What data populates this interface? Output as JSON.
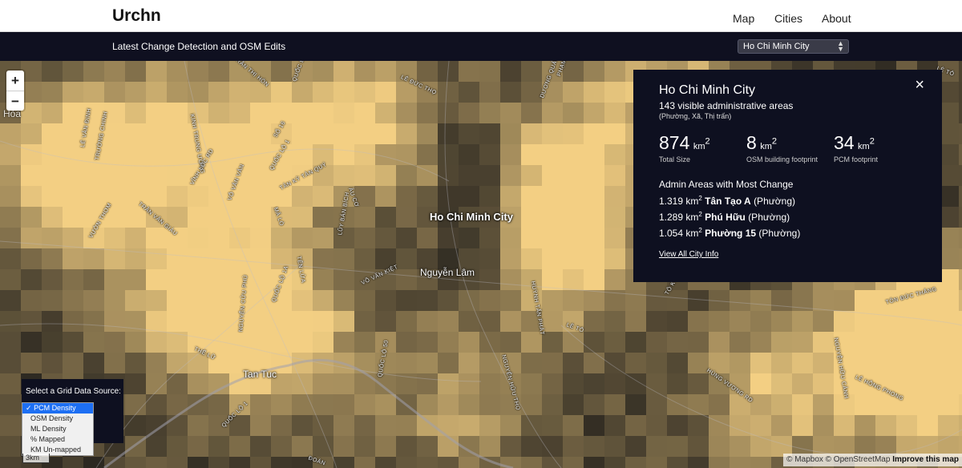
{
  "header": {
    "brand": "Urchn",
    "nav": [
      "Map",
      "Cities",
      "About"
    ]
  },
  "subheader": {
    "title": "Latest Change Detection and OSM Edits",
    "city_select": "Ho Chi Minh City"
  },
  "map": {
    "zoom_in": "+",
    "zoom_out": "−",
    "edge_label": "Hòa",
    "places": {
      "center": "Ho Chi Minh City",
      "nguyen_lam": "Nguyễn Lâm",
      "tan_tuc": "Tan Tuc"
    },
    "streets": [
      {
        "text": "LÊ ĐỨC THỌ"
      },
      {
        "text": "TRẦN THỊ HÒN"
      },
      {
        "text": "TÔ KÝ"
      },
      {
        "text": "QUỐC LỘ 22"
      },
      {
        "text": "DƯƠNG QUẢNG HÀM"
      },
      {
        "text": "SỐ 16"
      },
      {
        "text": "TÂN KỲ TÂN QUÝ"
      },
      {
        "text": "QUỐC LỘ 1"
      },
      {
        "text": "TRƯỜNG CHINH"
      },
      {
        "text": "KINH TRUNG ƯƠNG"
      },
      {
        "text": "VĨNH LỘC RD"
      },
      {
        "text": "VÕ VĂN VÂN"
      },
      {
        "text": "ÂU CƠ"
      },
      {
        "text": "TRẦN VĂN GIÀU"
      },
      {
        "text": "VƯỜN THƠM"
      },
      {
        "text": "LÊ VĂN ĐỊNH"
      },
      {
        "text": "LŨY BÁN BÍCH"
      },
      {
        "text": "MÃ LÒ"
      },
      {
        "text": "TÊN LỬA"
      },
      {
        "text": "VÕ VĂN KIỆT"
      },
      {
        "text": "QUỐC LỘ 1A"
      },
      {
        "text": "NGUYỄN CỬU PHÚ"
      },
      {
        "text": "HUỲNH TẤN PHÁT"
      },
      {
        "text": "THẾ LỮ"
      },
      {
        "text": "QUỐC LỘ 50"
      },
      {
        "text": "NGUYỄN HỮU THỌ"
      },
      {
        "text": "HÙNG VƯƠNG RD"
      },
      {
        "text": "NGUYỄN HỮU CẢNH"
      },
      {
        "text": "LÊ HỒNG PHONG"
      },
      {
        "text": "TÔN ĐỨC THẮNG"
      },
      {
        "text": "ĐOÀN"
      },
      {
        "text": "PHẠM"
      },
      {
        "text": "LÊ TÔ"
      },
      {
        "text": "LÊ TÔ"
      },
      {
        "text": "QUỐC LỘ 1"
      }
    ],
    "colors": {
      "dark": "#2b2720",
      "light": "#f3cf83",
      "panel": "#0e1020"
    }
  },
  "info_panel": {
    "close": "×",
    "city": "Ho Chi Minh City",
    "visible_areas": "143 visible administrative areas",
    "area_types": "(Phường, Xã, Thị trấn)",
    "stats": [
      {
        "value": "874",
        "unit": "km",
        "sup": "2",
        "label": "Total Size"
      },
      {
        "value": "8",
        "unit": "km",
        "sup": "2",
        "label": "OSM building footprint"
      },
      {
        "value": "34",
        "unit": "km",
        "sup": "2",
        "label": "PCM footprint"
      }
    ],
    "section_title": "Admin Areas with Most Change",
    "areas": [
      {
        "value": "1.319 km",
        "sup": "2",
        "name": "Tân Tạo A",
        "type": "(Phường)"
      },
      {
        "value": "1.289 km",
        "sup": "2",
        "name": "Phú Hữu",
        "type": "(Phường)"
      },
      {
        "value": "1.054 km",
        "sup": "2",
        "name": "Phường 15",
        "type": "(Phường)"
      }
    ],
    "link": "View All City Info"
  },
  "grid_source": {
    "title": "Select a Grid Data Source:",
    "options": [
      "PCM Density",
      "OSM Density",
      "ML Density",
      "% Mapped",
      "KM Un-mapped"
    ],
    "selected": "PCM Density",
    "check": "✓"
  },
  "scale": "3km",
  "attribution": {
    "text": "© Mapbox © OpenStreetMap",
    "improve": "Improve this map"
  }
}
